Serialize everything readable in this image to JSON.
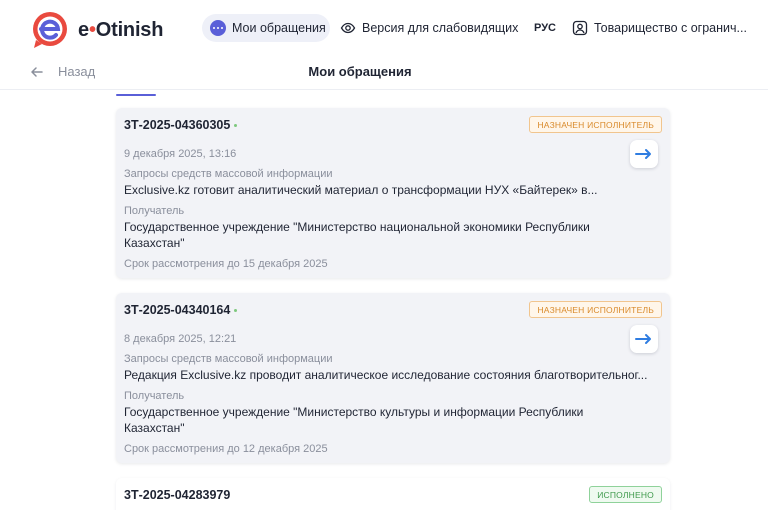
{
  "header": {
    "logo_text_e": "e",
    "logo_text_rest": "Otinish",
    "nav": {
      "my_requests": "Мои обращения",
      "low_vision": "Версия для слабовидящих",
      "lang": "РУС",
      "org": "Товарищество с огранич..."
    }
  },
  "subheader": {
    "back_label": "Назад",
    "title": "Мои обращения"
  },
  "cards": [
    {
      "number": "3Т-2025-04360305",
      "status": "НАЗНАЧЕН ИСПОЛНИТЕЛЬ",
      "date": "9 декабря 2025, 13:16",
      "category": "Запросы средств массовой информации",
      "subject": "Exclusive.kz готовит аналитический материал о трансформации НУХ «Байтерек» в...",
      "recipient_label": "Получатель",
      "recipient": "Государственное учреждение \"Министерство национальной экономики Республики Казахстан\"",
      "deadline": "Срок рассмотрения до 15 декабря 2025"
    },
    {
      "number": "3Т-2025-04340164",
      "status": "НАЗНАЧЕН ИСПОЛНИТЕЛЬ",
      "date": "8 декабря 2025, 12:21",
      "category": "Запросы средств массовой информации",
      "subject": "Редакция Exclusive.kz проводит аналитическое исследование состояния благотворительног...",
      "recipient_label": "Получатель",
      "recipient": "Государственное учреждение \"Министерство культуры и информации Республики Казахстан\"",
      "deadline": "Срок рассмотрения до 12 декабря 2025"
    },
    {
      "number": "3Т-2025-04283979",
      "status": "ИСПОЛНЕНО"
    }
  ],
  "colors": {
    "accent": "#5a5fd8",
    "arrow": "#2f7de1",
    "status_assigned": "#d98a2b",
    "status_done": "#3f9a4c",
    "logo_red": "#e94a3f"
  },
  "icons": {
    "nav_my_requests": "chat-bubble-icon",
    "nav_low_vision": "eye-icon",
    "nav_org": "user-square-icon",
    "back": "arrow-left-icon",
    "open": "arrow-right-icon"
  }
}
